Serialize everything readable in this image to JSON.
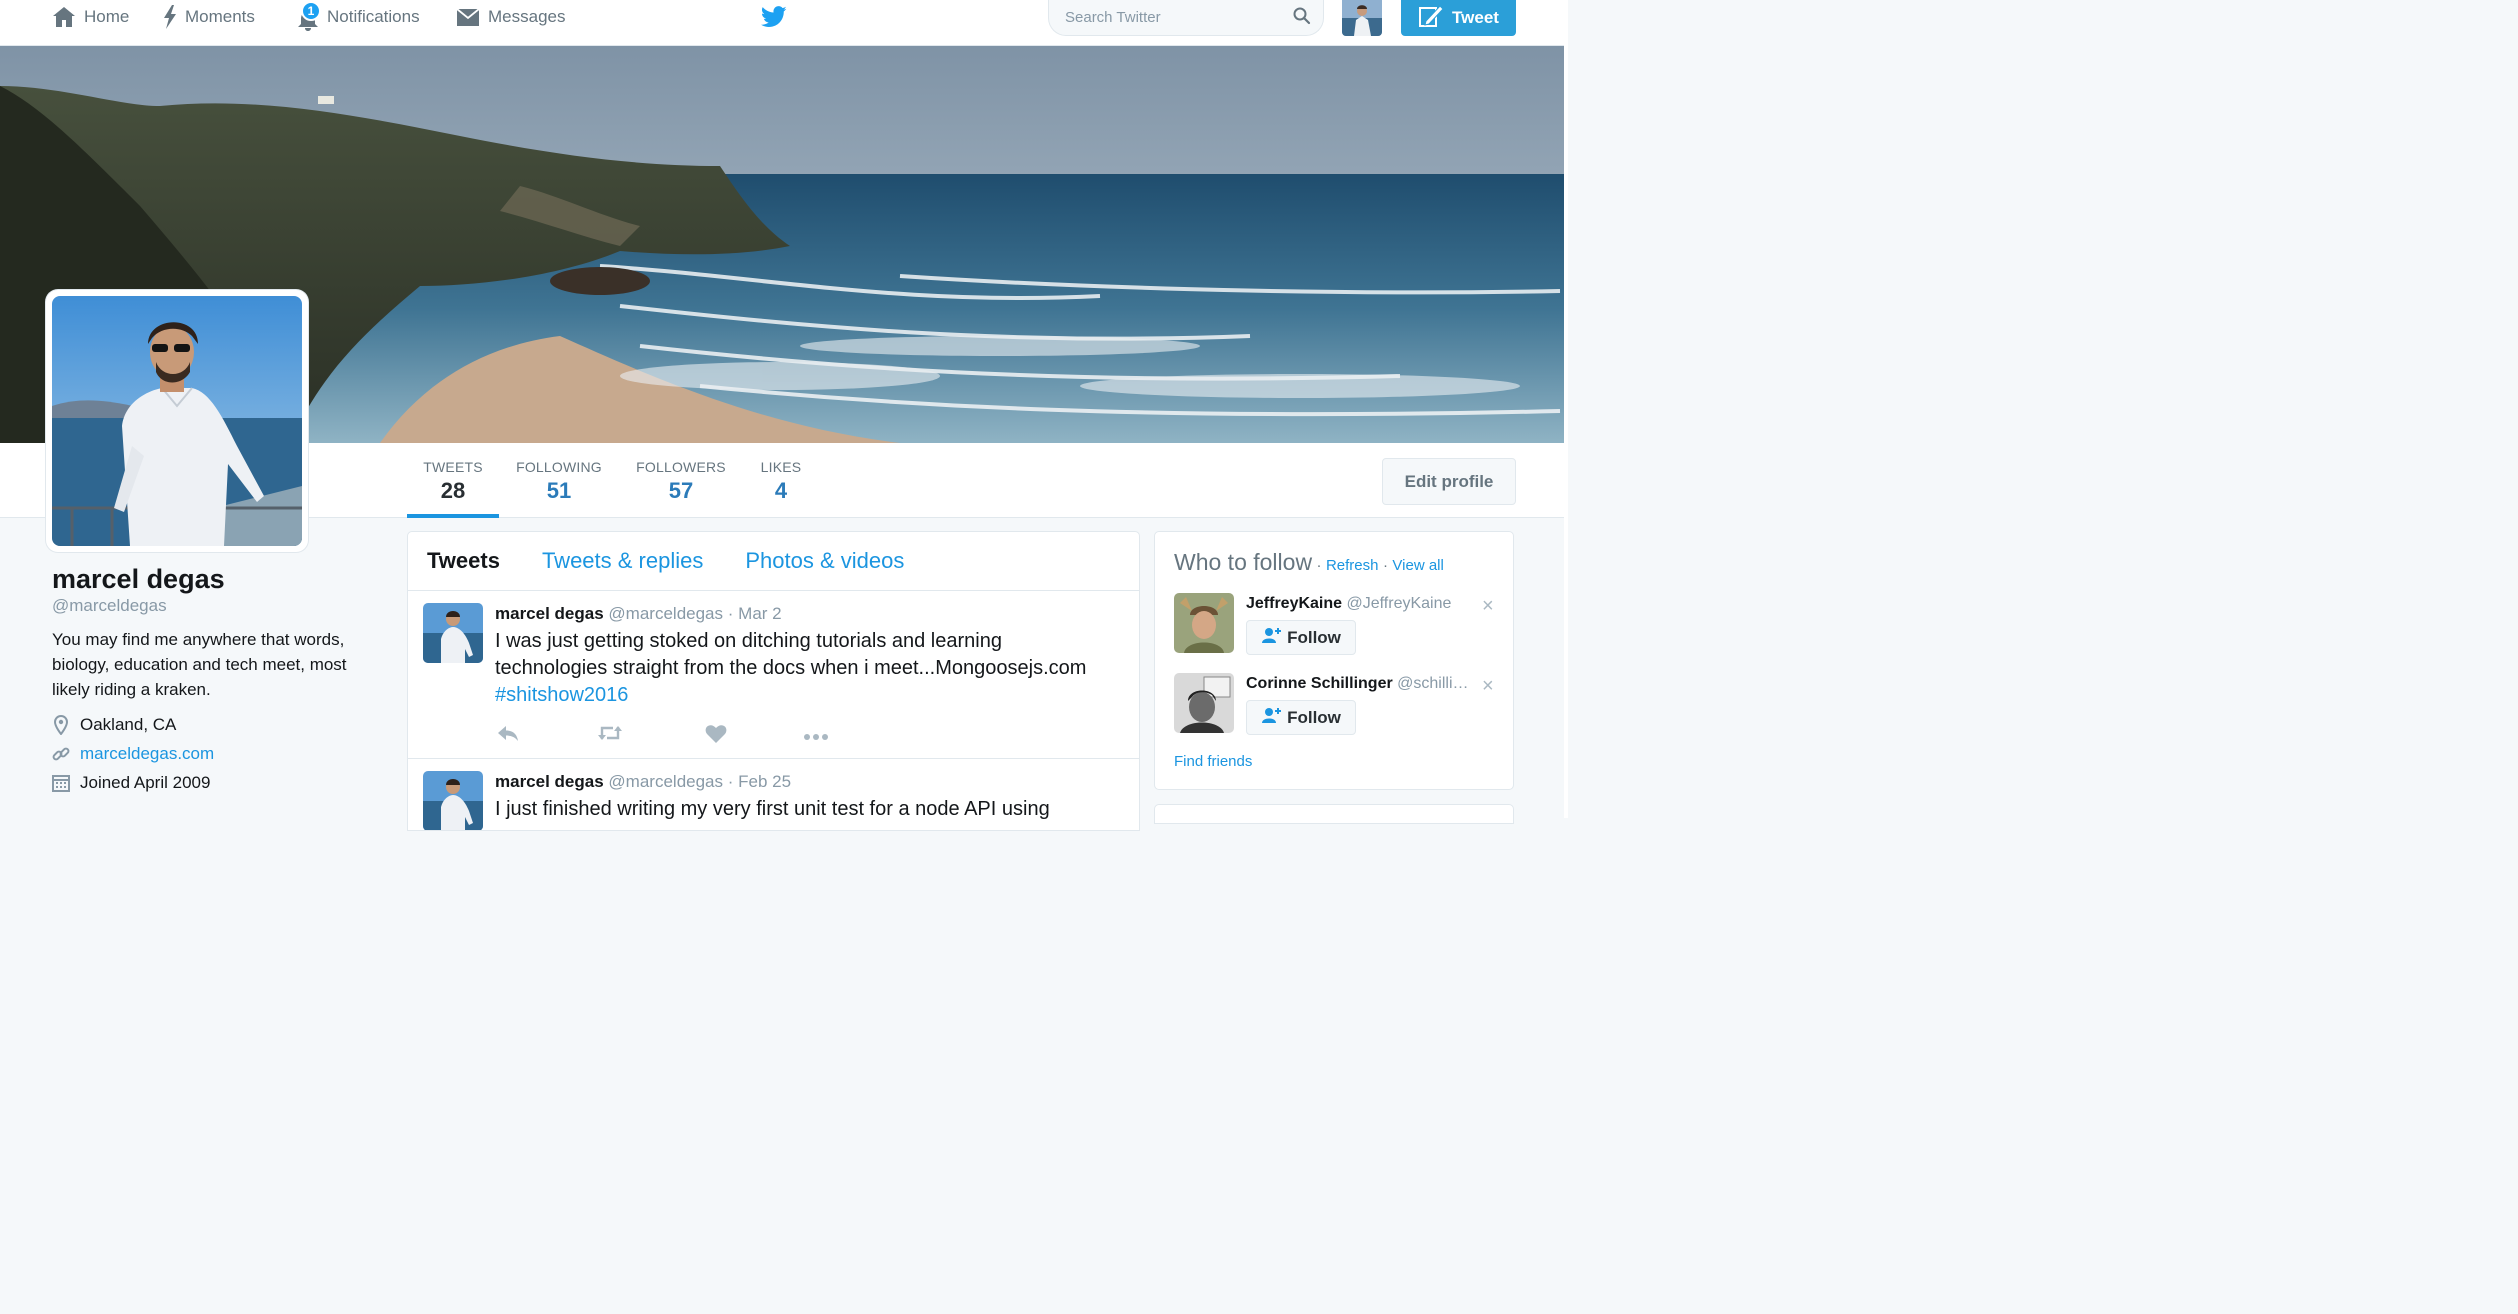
{
  "nav": {
    "home": "Home",
    "moments": "Moments",
    "notifications": "Notifications",
    "notifications_count": "1",
    "messages": "Messages",
    "search_placeholder": "Search Twitter",
    "tweet_button": "Tweet",
    "icons": [
      "home-icon",
      "lightning-icon",
      "bell-icon",
      "envelope-icon",
      "twitter-bird-icon",
      "search-icon",
      "compose-icon"
    ]
  },
  "profile": {
    "name": "marcel degas",
    "handle": "@marceldegas",
    "bio": "You may find me anywhere that words, biology, education and tech meet, most likely riding a kraken.",
    "location": "Oakland, CA",
    "website": "marceldegas.com",
    "joined": "Joined April 2009",
    "edit_button": "Edit profile"
  },
  "stats": [
    {
      "label": "TWEETS",
      "value": "28"
    },
    {
      "label": "FOLLOWING",
      "value": "51"
    },
    {
      "label": "FOLLOWERS",
      "value": "57"
    },
    {
      "label": "LIKES",
      "value": "4"
    }
  ],
  "timeline": {
    "tabs": [
      "Tweets",
      "Tweets & replies",
      "Photos & videos"
    ],
    "tweets": [
      {
        "name": "marcel degas",
        "handle": "@marceldegas",
        "dot": "·",
        "date": "Mar 2",
        "text": "I was just getting stoked on ditching tutorials and learning technologies straight from the docs when i meet...Mongoosejs.com",
        "hashtag": "#shitshow2016"
      },
      {
        "name": "marcel degas",
        "handle": "@marceldegas",
        "dot": "·",
        "date": "Feb 25",
        "text": "I just finished writing my very first unit test for a node API using"
      }
    ]
  },
  "who_to_follow": {
    "title": "Who to follow",
    "sep": "·",
    "refresh": "Refresh",
    "view_all": "View all",
    "suggestions": [
      {
        "name": "JeffreyKaine",
        "handle": "@JeffreyKaine",
        "follow": "Follow",
        "close": "×"
      },
      {
        "name": "Corinne Schillinger",
        "handle": "@schilli…",
        "follow": "Follow",
        "close": "×"
      }
    ],
    "find_friends": "Find friends"
  },
  "colors": {
    "accent": "#1b95e0",
    "tweet_button": "#2b9fd8",
    "text": "#14171a",
    "muted": "#8899a6",
    "border": "#e1e8ed",
    "background": "#f5f8fa"
  }
}
